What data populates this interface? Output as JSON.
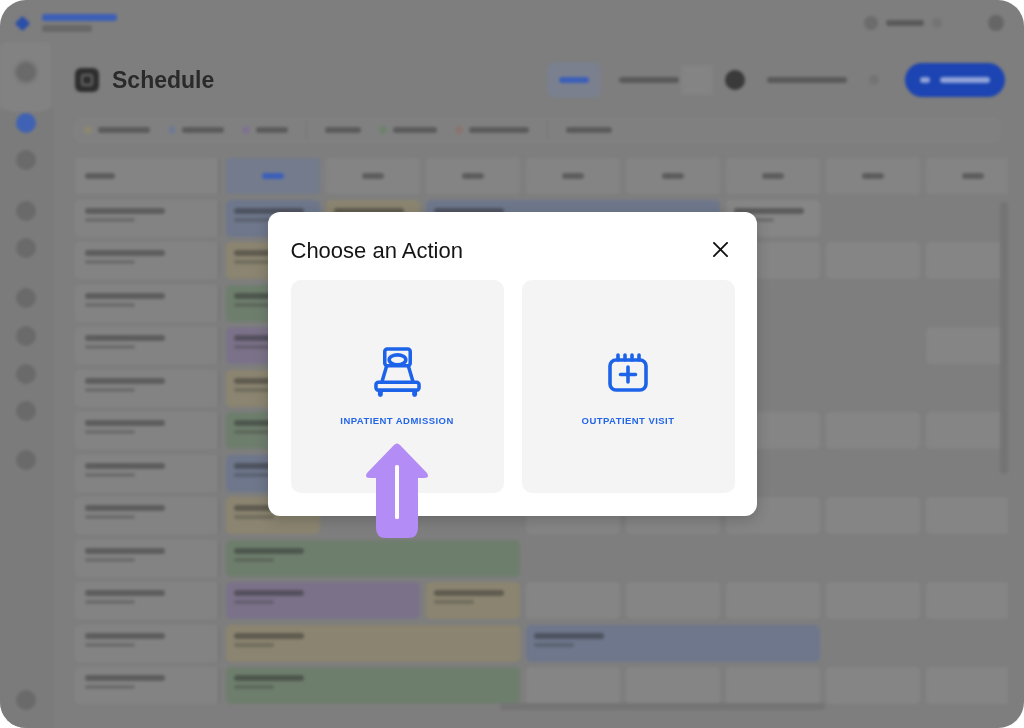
{
  "page": {
    "title": "Schedule"
  },
  "dialog": {
    "title": "Choose an Action",
    "actions": [
      {
        "kind": "bed",
        "label": "INPATIENT ADMISSION",
        "arrow": true
      },
      {
        "kind": "calendar",
        "label": "OUTPATIENT VISIT",
        "arrow": false
      }
    ]
  }
}
